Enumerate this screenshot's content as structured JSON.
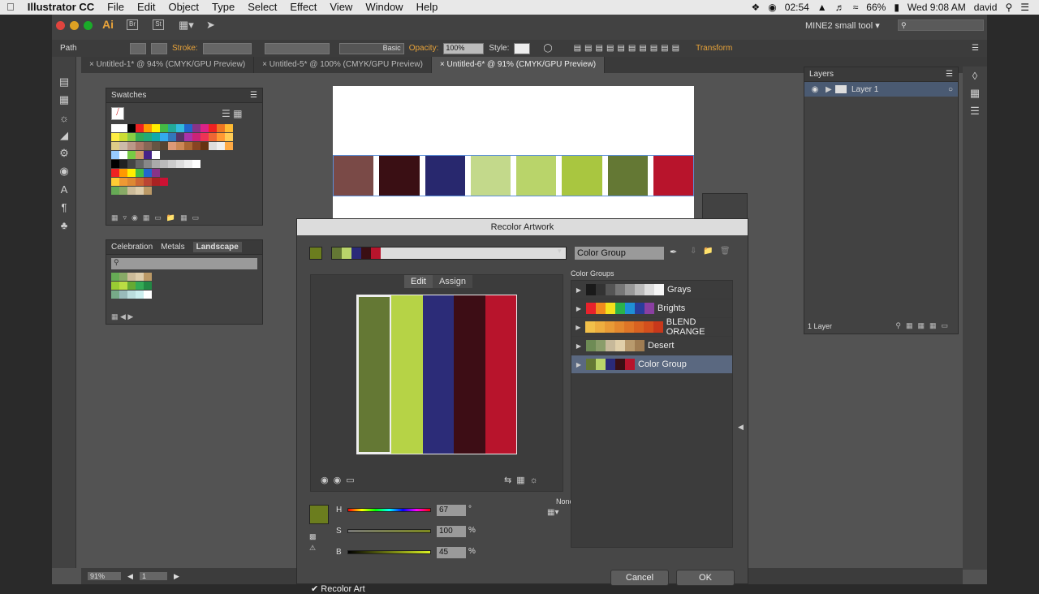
{
  "menubar": {
    "apple": "",
    "app_name": "Illustrator CC",
    "items": [
      "File",
      "Edit",
      "Object",
      "Type",
      "Select",
      "Effect",
      "View",
      "Window",
      "Help"
    ],
    "battery": "66%",
    "time_small": "02:54",
    "clock": "Wed 9:08 AM",
    "user": "david"
  },
  "control": {
    "ai_logo": "Ai",
    "br": "Br",
    "st": "St",
    "workspace": "MINE2 small tool",
    "selection": "Path",
    "stroke_label": "Stroke:",
    "brush": "Basic",
    "opacity_label": "Opacity:",
    "opacity_value": "100%",
    "style_label": "Style:",
    "transform_label": "Transform"
  },
  "tabs": [
    {
      "label": "Untitled-1* @ 94% (CMYK/GPU Preview)"
    },
    {
      "label": "Untitled-5* @ 100% (CMYK/GPU Preview)"
    },
    {
      "label": "Untitled-6* @ 91% (CMYK/GPU Preview)"
    }
  ],
  "swatches_panel": {
    "title": "Swatches"
  },
  "library_panel": {
    "tabs": [
      "Celebration",
      "Metals",
      "Landscape"
    ]
  },
  "layers_panel": {
    "title": "Layers",
    "layer_name": "Layer 1",
    "footer": "1 Layer"
  },
  "artwork_stripes": [
    "#7a4a47",
    "#3a0f14",
    "#28286e",
    "#c3d98b",
    "#b9d46a",
    "#a9c640",
    "#647834",
    "#b8142c"
  ],
  "status": {
    "zoom": "91%",
    "page": "1"
  },
  "recolor": {
    "title": "Recolor Artwork",
    "group_name": "Color Group",
    "tab_edit": "Edit",
    "tab_assign": "Assign",
    "groups_label": "Color Groups",
    "none_label": "None",
    "groups": [
      {
        "name": "Grays",
        "colors": [
          "#1a1a1a",
          "#333",
          "#555",
          "#777",
          "#999",
          "#bbb",
          "#ddd",
          "#f5f5f5"
        ]
      },
      {
        "name": "Brights",
        "colors": [
          "#e8222c",
          "#f08b1e",
          "#f4e01c",
          "#2bb34a",
          "#1f8fd6",
          "#2a3d9c",
          "#8a3fa1"
        ]
      },
      {
        "name": "BLEND ORANGE",
        "colors": [
          "#f2c04a",
          "#eeae3f",
          "#e99b36",
          "#e4882e",
          "#df7527",
          "#d96221",
          "#d44f1d",
          "#c8381b"
        ]
      },
      {
        "name": "Desert",
        "colors": [
          "#6e8b55",
          "#8a9d6a",
          "#c7b99a",
          "#e0cfa9",
          "#b89a6d",
          "#9f7c52"
        ]
      },
      {
        "name": "Color Group",
        "colors": [
          "#647834",
          "#b9d46a",
          "#2a2a78",
          "#3a0f14",
          "#b8142c"
        ]
      }
    ],
    "edit_bars": [
      "#647834",
      "#b6d346",
      "#2c2c78",
      "#3d0d15",
      "#b8142c"
    ],
    "h_label": "H",
    "h_value": "67",
    "h_unit": "°",
    "s_label": "S",
    "s_value": "100",
    "s_unit": "%",
    "b_label": "B",
    "b_value": "45",
    "b_unit": "%",
    "recolor_art_label": "Recolor Art",
    "cancel": "Cancel",
    "ok": "OK",
    "current_color": "#6b7d1e"
  }
}
